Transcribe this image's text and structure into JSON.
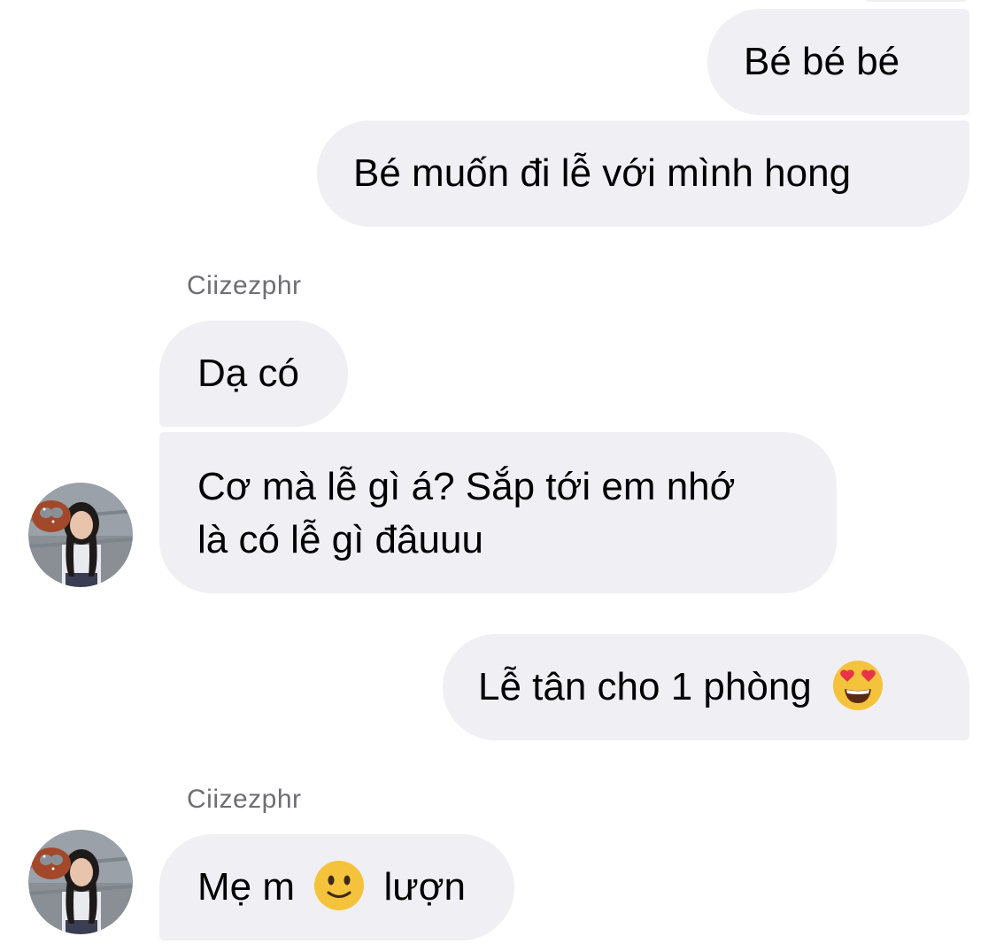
{
  "conversation": {
    "messages": [
      {
        "side": "outgoing",
        "text": "Bé bé bé"
      },
      {
        "side": "outgoing",
        "text": "Bé muốn đi lễ với mình hong"
      },
      {
        "side": "incoming",
        "sender": "Ciizezphr",
        "text": "Dạ có"
      },
      {
        "side": "incoming",
        "text_line1": "Cơ mà lễ gì á? Sắp tới em nhớ",
        "text_line2": "là có lễ gì đâuuu"
      },
      {
        "side": "outgoing",
        "text": "Lễ tân cho 1 phòng",
        "emoji": "heart-eyes-emoji"
      },
      {
        "side": "incoming",
        "sender": "Ciizezphr",
        "text_before": "Mẹ m",
        "emoji": "slightly-smiling-emoji",
        "text_after": "lượn"
      }
    ]
  },
  "colors": {
    "bubble_background": "#efeff4",
    "sender_name_text": "#6e6e73",
    "message_text": "#000000"
  }
}
